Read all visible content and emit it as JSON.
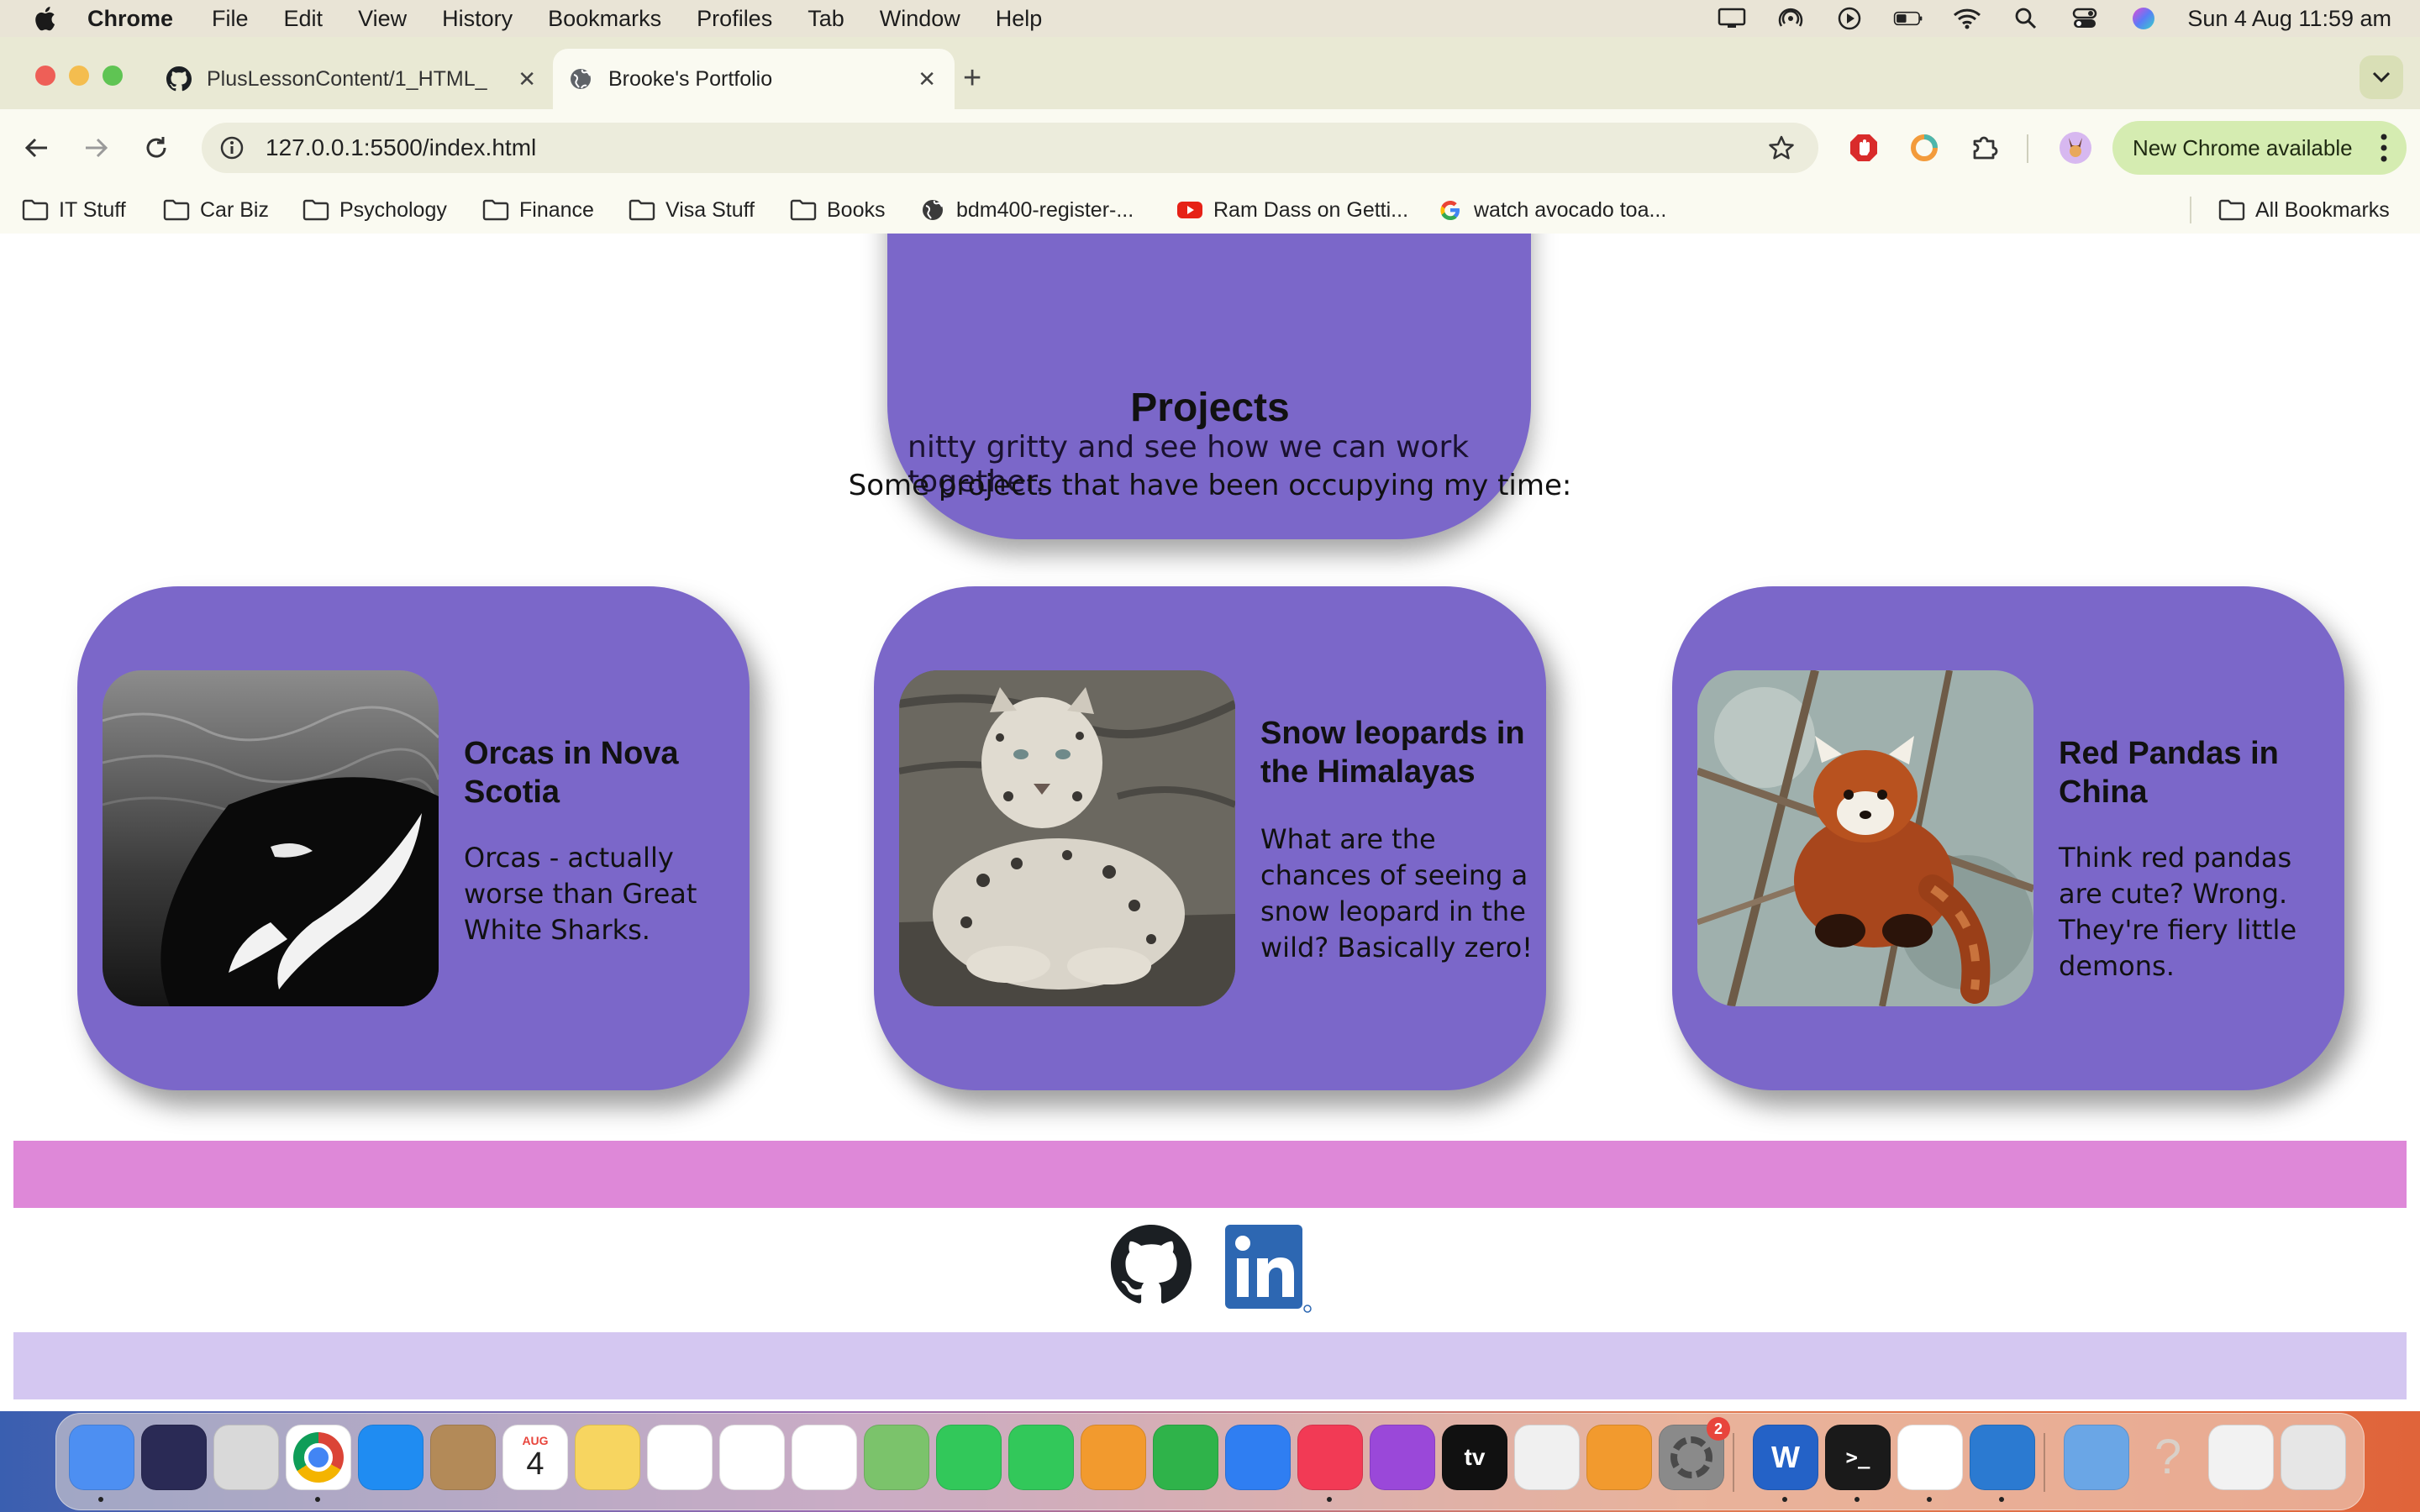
{
  "menubar": {
    "app_name": "Chrome",
    "items": [
      "File",
      "Edit",
      "View",
      "History",
      "Bookmarks",
      "Profiles",
      "Tab",
      "Window",
      "Help"
    ],
    "clock": "Sun 4 Aug  11:59 am"
  },
  "tabs": [
    {
      "title": "PlusLessonContent/1_HTML_",
      "icon": "github-icon"
    },
    {
      "title": "Brooke's Portfolio",
      "icon": "globe-icon",
      "active": true
    }
  ],
  "toolbar": {
    "url": "127.0.0.1:5500/index.html",
    "update_label": "New Chrome available"
  },
  "bookmarks": [
    {
      "label": "IT Stuff",
      "icon": "folder-icon"
    },
    {
      "label": "Car Biz",
      "icon": "folder-icon"
    },
    {
      "label": "Psychology",
      "icon": "folder-icon"
    },
    {
      "label": "Finance",
      "icon": "folder-icon"
    },
    {
      "label": "Visa Stuff",
      "icon": "folder-icon"
    },
    {
      "label": "Books",
      "icon": "folder-icon"
    },
    {
      "label": "bdm400-register-...",
      "icon": "globe-icon"
    },
    {
      "label": "Ram Dass on Getti...",
      "icon": "youtube-icon"
    },
    {
      "label": "watch avocado toa...",
      "icon": "google-icon"
    }
  ],
  "all_bookmarks_label": "All Bookmarks",
  "page": {
    "about_tail_text": "nitty gritty and see how we can work together.",
    "projects_heading": "Projects",
    "projects_subtitle": "Some projects that have been occupying my time:",
    "projects": [
      {
        "title": "Orcas in Nova Scotia",
        "description": "Orcas - actually worse than Great White Sharks.",
        "image": "orca-photo"
      },
      {
        "title": "Snow leopards in the Himalayas",
        "description": "What are the chances of seeing a snow leopard in the wild? Basically zero!",
        "image": "snow-leopard-photo"
      },
      {
        "title": "Red Pandas in China",
        "description": "Think red pandas are cute? Wrong. They're fiery little demons.",
        "image": "red-panda-photo"
      }
    ],
    "footer_links": [
      "github-icon",
      "linkedin-icon"
    ],
    "colors": {
      "card": "#7b67c9",
      "footer_top": "#de88d8",
      "footer_bottom": "#d4c7f1"
    }
  },
  "dock": {
    "apps": [
      "Finder",
      "Siri",
      "Launchpad",
      "Chrome",
      "App Store",
      "Contacts",
      "Calendar",
      "Notes",
      "Freeform",
      "Reminders",
      "Photos",
      "Maps",
      "Messages",
      "FaceTime",
      "Pages",
      "Numbers",
      "Keynote",
      "Music",
      "Podcasts",
      "TV",
      "News",
      "Books",
      "System Settings",
      "Word",
      "Terminal",
      "Slack",
      "Visual Studio Code",
      "Downloads",
      "Help",
      "Preview",
      "Trash"
    ],
    "calendar_month": "AUG",
    "calendar_day": "4",
    "settings_badge": "2",
    "tv_label": "tv"
  }
}
